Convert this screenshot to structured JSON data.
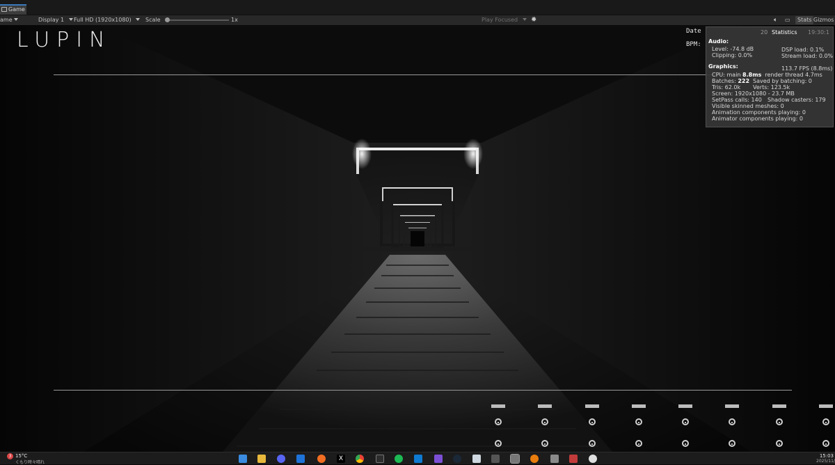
{
  "window": {
    "tab_label": "Game"
  },
  "toolbar": {
    "view_select": "ame",
    "display_select": "Display 1",
    "resolution_select": "Full HD (1920x1080)",
    "scale_label": "Scale",
    "scale_value": "1x",
    "play_mode": "Play Focused",
    "stats_button": "Stats",
    "gizmos_button": "Gizmos"
  },
  "game": {
    "logo": "LUPIN",
    "date_label": "Date",
    "bpm_label": "BPM:",
    "date_value_hidden": "20",
    "time_value_hidden": "19:30:1",
    "fader_count": 8
  },
  "stats": {
    "title": "Statistics",
    "audio_header": "Audio:",
    "level": "Level: -74.8 dB",
    "clipping": "Clipping: 0.0%",
    "dsp_load": "DSP load: 0.1%",
    "stream_load": "Stream load: 0.0%",
    "graphics_header": "Graphics:",
    "fps": "113.7 FPS (8.8ms)",
    "cpu_prefix": "CPU: main ",
    "cpu_main": "8.8ms",
    "render_thread": "render thread 4.7ms",
    "batches_prefix": "Batches: ",
    "batches": "222",
    "saved_by_batching": "Saved by batching: 0",
    "tris": "Tris: 62.0k",
    "verts": "Verts: 123.5k",
    "screen": "Screen: 1920x1080 - 23.7 MB",
    "setpass": "SetPass calls: 140",
    "shadow_casters": "Shadow casters: 179",
    "skinned_meshes": "Visible skinned meshes: 0",
    "animation_components": "Animation components playing: 0",
    "animator_components": "Animator components playing: 0"
  },
  "taskbar": {
    "weather_badge": "3",
    "temperature": "15°C",
    "weather_desc": "くもり時々晴れ",
    "time": "15:03",
    "date": "2025/11/"
  },
  "colors": {
    "accent": "#3a79bb",
    "hud_line": "#9a9a9a"
  }
}
